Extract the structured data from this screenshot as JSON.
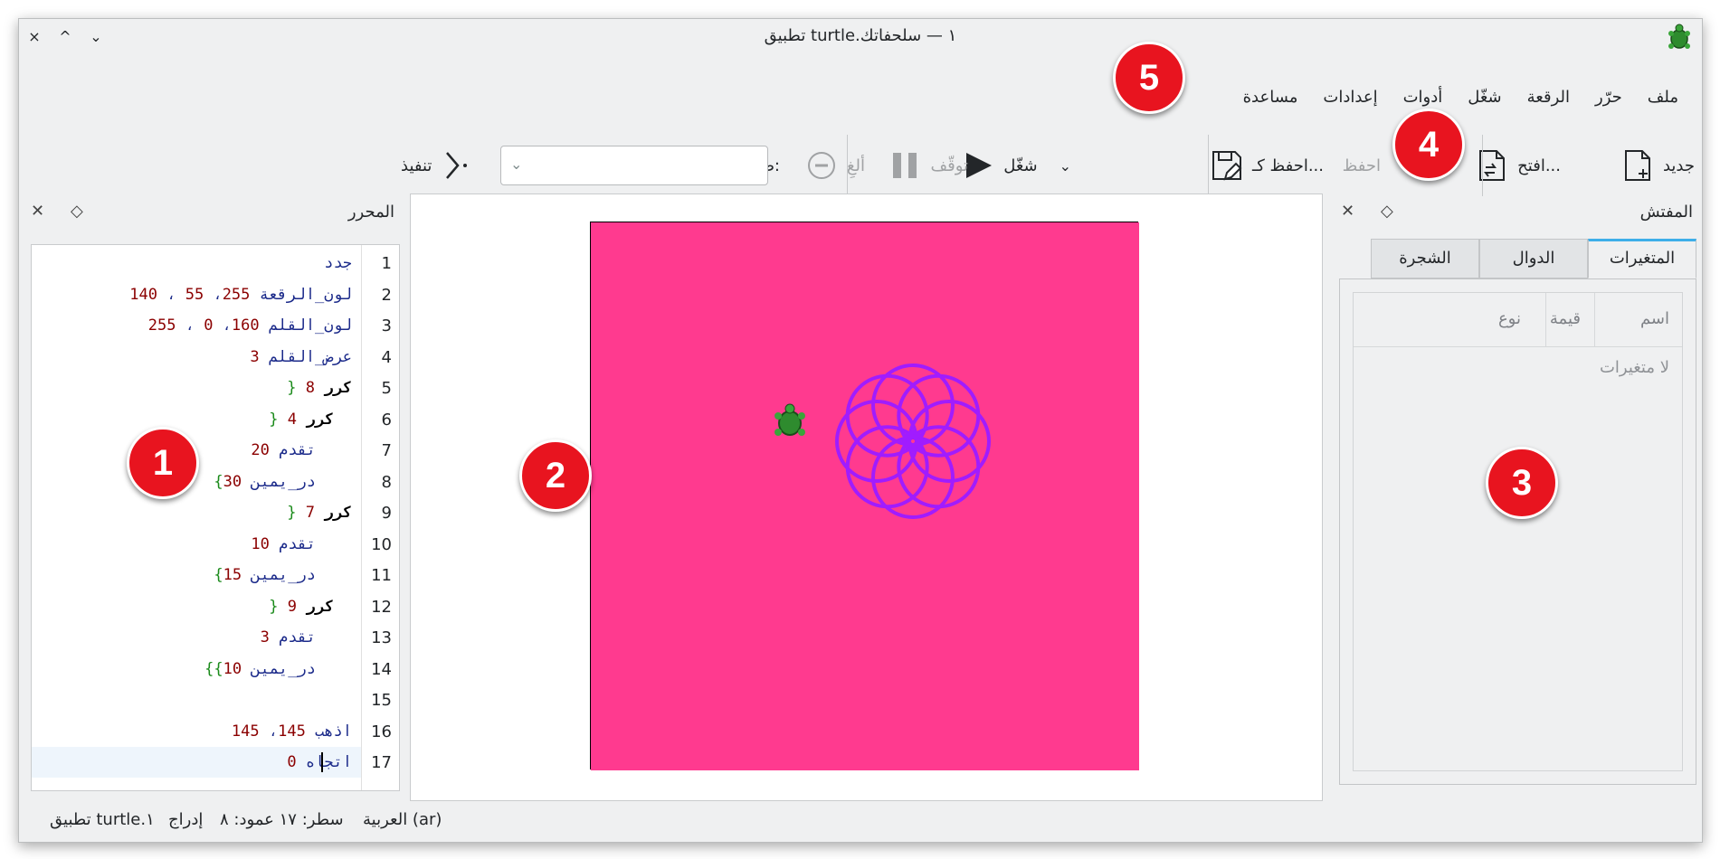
{
  "window": {
    "title": "تطبيق turtle.١ — سلحفاتك",
    "controls": [
      "×",
      "^",
      "⌄"
    ]
  },
  "menu": [
    "ملف",
    "حرّر",
    "الرقعة",
    "شغّل",
    "أدوات",
    "إعدادات",
    "مساعدة"
  ],
  "toolbar": {
    "new": "جديد",
    "open": "افتح...",
    "save": "احفظ",
    "save_as": "احفظ كـ...",
    "run": "شغّل",
    "pause": "توقّف",
    "abort": "ألغِ",
    "language_label": "طرفية:",
    "language_value": "",
    "execute": "تنفيذ"
  },
  "editor": {
    "title": "المحرر",
    "lines": [
      {
        "n": "1",
        "text": "جدد"
      },
      {
        "n": "2",
        "text": "لون_الرقعة 255، 55 ، 140"
      },
      {
        "n": "3",
        "text": "لون_القلم 160، 0 ، 255"
      },
      {
        "n": "4",
        "text": "عرض_القلم 3"
      },
      {
        "n": "5",
        "text": "كرر 8 {"
      },
      {
        "n": "6",
        "text": "كرر 4 {"
      },
      {
        "n": "7",
        "text": "تقدم 20"
      },
      {
        "n": "8",
        "text": "در_يمين 30}"
      },
      {
        "n": "9",
        "text": "كرر 7 {"
      },
      {
        "n": "10",
        "text": "تقدم 10"
      },
      {
        "n": "11",
        "text": "در_يمين 15}"
      },
      {
        "n": "12",
        "text": "كرر 9 {"
      },
      {
        "n": "13",
        "text": "تقدم 3"
      },
      {
        "n": "14",
        "text": "در_يمين 10}}"
      },
      {
        "n": "15",
        "text": ""
      },
      {
        "n": "16",
        "text": "اذهب 145، 145"
      },
      {
        "n": "17",
        "text": "اتجاه 0"
      }
    ]
  },
  "canvas": {
    "background": "#ff3a8f",
    "pen_color": "#a01cff"
  },
  "inspector": {
    "title": "المفتش",
    "tabs": [
      "المتغيرات",
      "الدوال",
      "الشجرة"
    ],
    "active_tab": "المتغيرات",
    "columns": [
      "اسم",
      "قيمة",
      "نوع"
    ],
    "empty": "لا متغيرات"
  },
  "status": {
    "language": "العربية (ar)",
    "position": "سطر: ١٧ عمود: ٨",
    "mode": "إدراج",
    "file": "تطبيق turtle.١"
  },
  "badges": [
    "1",
    "2",
    "3",
    "4",
    "5"
  ]
}
